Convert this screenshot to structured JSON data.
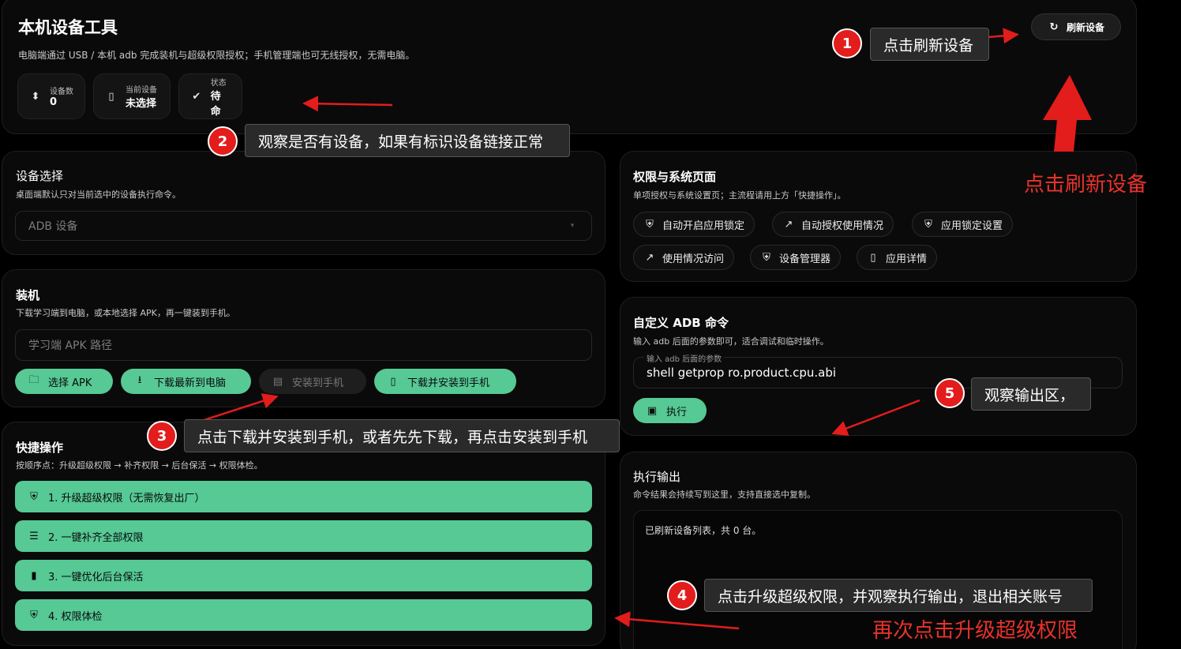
{
  "header": {
    "title": "本机设备工具",
    "subtitle": "电脑端通过 USB / 本机 adb 完成装机与超级权限授权；手机管理端也可无线授权，无需电脑。",
    "refresh_label": "刷新设备",
    "stats": [
      {
        "label": "设备数",
        "value": "0",
        "icon": "usb-icon"
      },
      {
        "label": "当前设备",
        "value": "未选择",
        "icon": "phone-icon"
      },
      {
        "label": "状态",
        "value": "待命",
        "icon": "check-circle-icon"
      }
    ]
  },
  "device_select": {
    "title": "设备选择",
    "subtitle": "桌面端默认只对当前选中的设备执行命令。",
    "select_value": "ADB 设备"
  },
  "install": {
    "title": "装机",
    "subtitle": "下载学习端到电脑，或本地选择 APK，再一键装到手机。",
    "apk_placeholder": "学习端 APK 路径",
    "buttons": {
      "choose": "选择 APK",
      "download": "下载最新到电脑",
      "install": "安装到手机",
      "download_install": "下载并安装到手机"
    }
  },
  "quick": {
    "title": "快捷操作",
    "subtitle": "按顺序点：升级超级权限 → 补齐权限 → 后台保活 → 权限体检。",
    "items": [
      "1. 升级超级权限（无需恢复出厂）",
      "2. 一键补齐全部权限",
      "3. 一键优化后台保活",
      "4. 权限体检"
    ]
  },
  "perm": {
    "title": "权限与系统页面",
    "subtitle": "单项授权与系统设置页；主流程请用上方「快捷操作」。",
    "buttons": [
      "自动开启应用锁定",
      "自动授权使用情况",
      "应用锁定设置",
      "使用情况访问",
      "设备管理器",
      "应用详情"
    ]
  },
  "adb": {
    "title": "自定义 ADB 命令",
    "subtitle": "输入 adb 后面的参数即可，适合调试和临时操作。",
    "field_label": "输入 adb 后面的参数",
    "field_value": "shell getprop ro.product.cpu.abi",
    "run_label": "执行"
  },
  "output": {
    "title": "执行输出",
    "subtitle": "命令结果会持续写到这里，支持直接选中复制。",
    "text": "已刷新设备列表，共 0 台。"
  },
  "annotations": {
    "c1": "点击刷新设备",
    "c2": "观察是否有设备，如果有标识设备链接正常",
    "c3": "点击下载并安装到手机，或者先先下载，再点击安装到手机",
    "c4": "点击升级超级权限，并观察执行输出，退出相关账号",
    "c5": "观察输出区，",
    "red1": "点击刷新设备",
    "red2": "再次点击升级超级权限",
    "n1": "1",
    "n2": "2",
    "n3": "3",
    "n4": "4",
    "n5": "5"
  },
  "colors": {
    "accent": "#56c995",
    "annotation_red": "#e31c1c",
    "background": "#000000"
  }
}
